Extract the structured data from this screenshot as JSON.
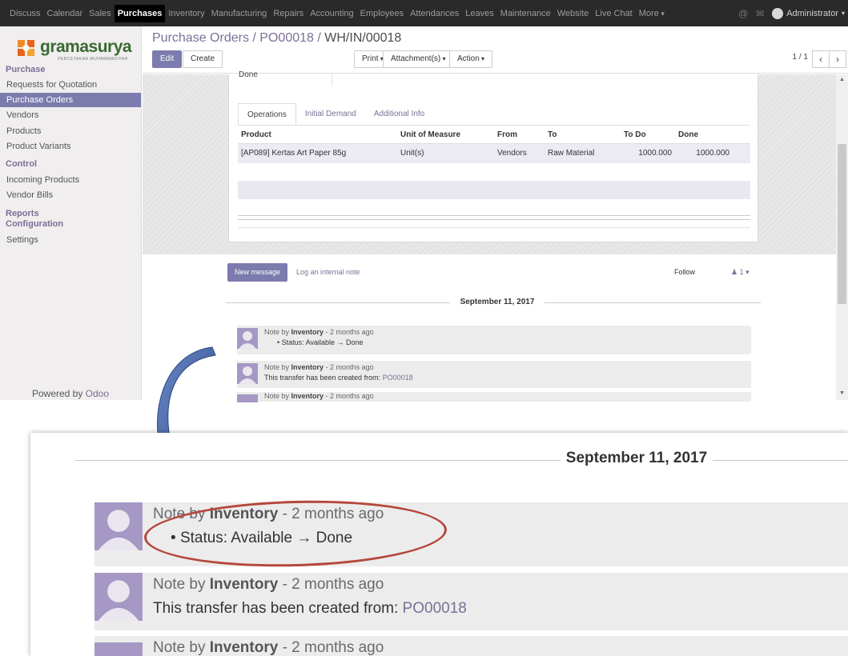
{
  "topbar": {
    "menu": [
      "Discuss",
      "Calendar",
      "Sales",
      "Purchases",
      "Inventory",
      "Manufacturing",
      "Repairs",
      "Accounting",
      "Employees",
      "Attendances",
      "Leaves",
      "Maintenance",
      "Website",
      "Live Chat"
    ],
    "active_menu": "Purchases",
    "more_label": "More",
    "user_name": "Administrator",
    "icons": [
      "at-icon",
      "chat-icon"
    ]
  },
  "logo": {
    "text": "gramasurya",
    "sub": "PERCETAKAN MUHAMMADIYAH"
  },
  "sidebar": {
    "sections": [
      {
        "title": "Purchase",
        "items": [
          "Requests for Quotation",
          "Purchase Orders",
          "Vendors",
          "Products",
          "Product Variants"
        ]
      },
      {
        "title": "Control",
        "items": [
          "Incoming Products",
          "Vendor Bills"
        ]
      },
      {
        "title": "Reports",
        "items": []
      },
      {
        "title": "Configuration",
        "items": [
          "Settings"
        ]
      }
    ],
    "active_item": "Purchase Orders",
    "powered_prefix": "Powered by ",
    "powered_brand": "Odoo"
  },
  "control_panel": {
    "breadcrumb": [
      "Purchase Orders",
      "PO00018"
    ],
    "breadcrumb_current": "WH/IN/00018",
    "separator": "/",
    "edit": "Edit",
    "create": "Create",
    "print": "Print",
    "attachments": "Attachment(s)",
    "action": "Action",
    "pager": "1 / 1",
    "prev_icon": "chevron-left-icon",
    "next_icon": "chevron-right-icon"
  },
  "form": {
    "cut_label": "Done",
    "tabs": [
      "Operations",
      "Initial Demand",
      "Additional Info"
    ],
    "active_tab": "Operations",
    "columns": [
      "Product",
      "Unit of Measure",
      "From",
      "To",
      "To Do",
      "Done"
    ],
    "rows": [
      [
        "[AP089] Kertas Art Paper 85g",
        "Unit(s)",
        "Vendors",
        "Raw Material",
        "1000.000",
        "1000.000"
      ]
    ]
  },
  "chatter": {
    "new_message": "New message",
    "log_note": "Log an internal note",
    "follow": "Follow",
    "followers": "1",
    "date": "September 11, 2017",
    "messages": [
      {
        "prefix": "Note by ",
        "author": "Inventory",
        "when": " - 2 months ago",
        "body": "Status: Available → Done",
        "bullet": true
      },
      {
        "prefix": "Note by ",
        "author": "Inventory",
        "when": " - 2 months ago",
        "body_prefix": "This transfer has been created from: ",
        "body_link": "PO00018"
      },
      {
        "prefix": "Note by ",
        "author": "Inventory",
        "when": " - 2 months ago"
      }
    ]
  },
  "zoom": {
    "date": "September 11, 2017",
    "messages": [
      {
        "prefix": "Note by ",
        "author": "Inventory",
        "when": " - 2 months ago",
        "body": "Status: Available → Done"
      },
      {
        "prefix": "Note by ",
        "author": "Inventory",
        "when": " - 2 months ago",
        "body_prefix": "This transfer has been created from: ",
        "body_link": "PO00018"
      },
      {
        "prefix": "Note by ",
        "author": "Inventory",
        "when": " - 2 months ago"
      }
    ]
  },
  "colors": {
    "brand": "#7c7bad",
    "topbar": "#2a2a2a",
    "highlight_oval": "#b5473b",
    "arrow": "#2f4f8f"
  }
}
